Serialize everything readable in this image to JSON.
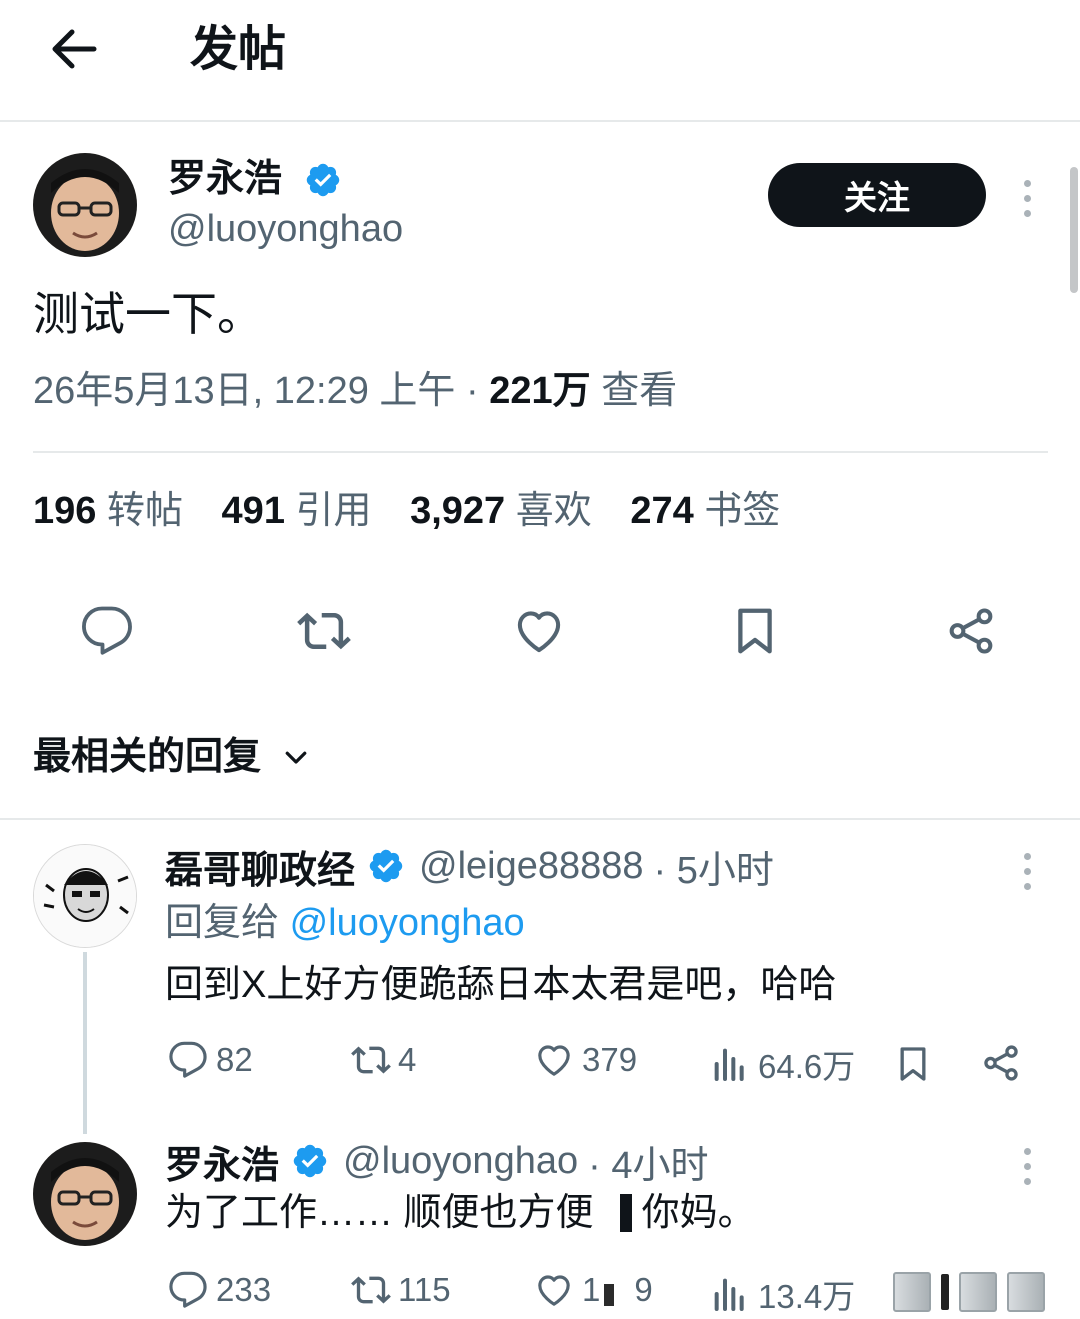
{
  "header": {
    "title": "发帖"
  },
  "post": {
    "author_name": "罗永浩",
    "author_handle": "@luoyonghao",
    "follow_label": "关注",
    "text": "测试一下。",
    "timestamp": "26年5月13日, 12:29 上午",
    "separator": "·",
    "views_count": "221万",
    "views_label": "查看",
    "stats": [
      {
        "count": "196",
        "label": "转帖"
      },
      {
        "count": "491",
        "label": "引用"
      },
      {
        "count": "3,927",
        "label": "喜欢"
      },
      {
        "count": "274",
        "label": "书签"
      }
    ]
  },
  "replies_sort": {
    "label": "最相关的回复"
  },
  "replies": [
    {
      "author_name": "磊哥聊政经",
      "author_handle": "@leige88888",
      "time": "· 5小时",
      "reply_to_prefix": "回复给",
      "reply_to_handle": "@luoyonghao",
      "text": "回到X上好方便跪舔日本太君是吧，哈哈",
      "counts": {
        "replies": "82",
        "reposts": "4",
        "likes": "379",
        "views": "64.6万"
      }
    },
    {
      "author_name": "罗永浩",
      "author_handle": "@luoyonghao",
      "time": "· 4小时",
      "text": "为了工作…… 顺便也方便",
      "text_tail": "你妈。",
      "counts": {
        "replies": "233",
        "reposts": "115",
        "likes": "1",
        "likes_tail": "9",
        "views": "13.4万"
      }
    }
  ],
  "colors": {
    "text": "#0f1419",
    "secondary": "#536471",
    "accent": "#1d9bf0",
    "border": "#e6e9ea"
  },
  "icons": [
    "back-arrow-icon",
    "verified-badge-icon",
    "more-icon",
    "reply-icon",
    "repost-icon",
    "like-icon",
    "bookmark-icon",
    "share-icon",
    "views-icon",
    "chevron-down-icon"
  ]
}
